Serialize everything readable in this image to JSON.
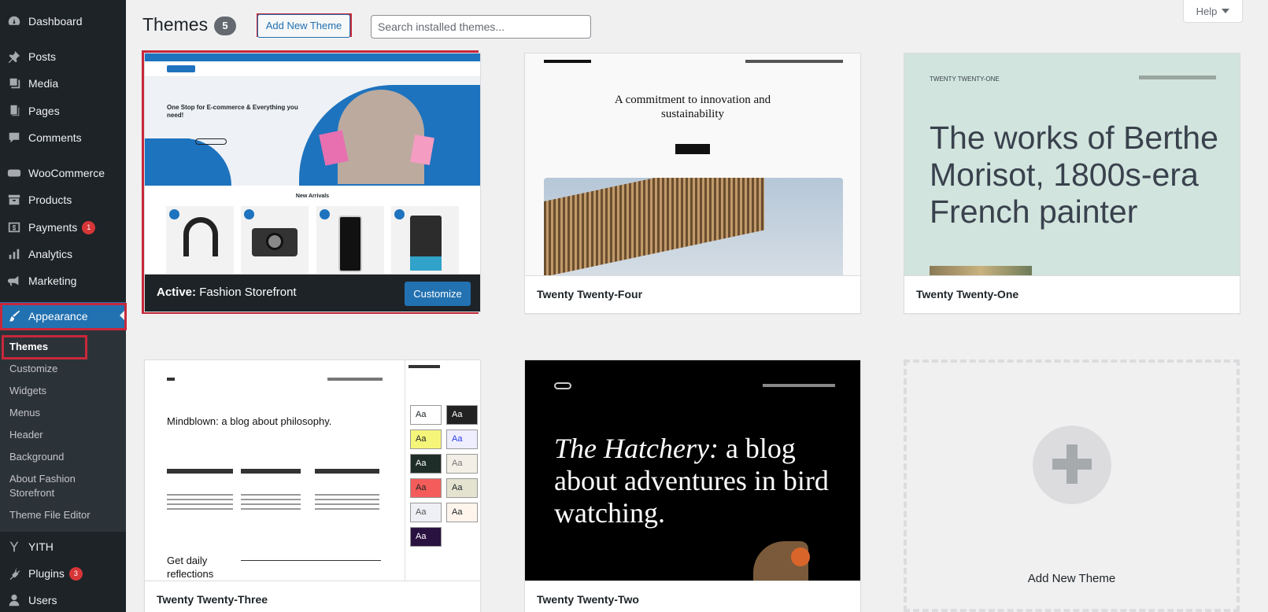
{
  "sidebar": {
    "items": [
      {
        "label": "Dashboard",
        "icon": "dashboard-icon"
      },
      {
        "label": "Posts",
        "icon": "pushpin-icon"
      },
      {
        "label": "Media",
        "icon": "media-icon"
      },
      {
        "label": "Pages",
        "icon": "pages-icon"
      },
      {
        "label": "Comments",
        "icon": "comment-icon"
      },
      {
        "label": "WooCommerce",
        "icon": "woo-icon"
      },
      {
        "label": "Products",
        "icon": "archive-icon"
      },
      {
        "label": "Payments",
        "icon": "payments-icon",
        "badge": "1"
      },
      {
        "label": "Analytics",
        "icon": "chart-bar-icon"
      },
      {
        "label": "Marketing",
        "icon": "megaphone-icon"
      },
      {
        "label": "Appearance",
        "icon": "paintbrush-icon"
      },
      {
        "label": "YITH",
        "icon": "yith-icon"
      },
      {
        "label": "Plugins",
        "icon": "plugin-icon",
        "badge": "3"
      },
      {
        "label": "Users",
        "icon": "users-icon"
      }
    ],
    "submenu": [
      "Themes",
      "Customize",
      "Widgets",
      "Menus",
      "Header",
      "Background",
      "About Fashion Storefront",
      "Theme File Editor"
    ]
  },
  "header": {
    "title": "Themes",
    "count": "5",
    "add_new_label": "Add New Theme",
    "search_placeholder": "Search installed themes...",
    "help_label": "Help"
  },
  "themes": [
    {
      "name": "Fashion Storefront",
      "active_prefix": "Active:",
      "customize_label": "Customize"
    },
    {
      "name": "Twenty Twenty-Four",
      "preview_heading": "A commitment to innovation and sustainability"
    },
    {
      "name": "Twenty Twenty-One",
      "preview_heading": "The works of Berthe Morisot, 1800s-era French painter",
      "preview_site": "TWENTY TWENTY-ONE"
    },
    {
      "name": "Twenty Twenty-Three",
      "preview_heading": "Mindblown: a blog about philosophy.",
      "preview_footer": "Get daily reflections"
    },
    {
      "name": "Twenty Twenty-Two",
      "preview_heading_em": "The Hatchery:",
      "preview_heading_rest": " a blog about adventures in bird watching."
    }
  ],
  "add_card": {
    "label": "Add New Theme"
  },
  "colors": {
    "accent": "#2271b1",
    "highlight": "#c8283b",
    "sidebar": "#1d2327"
  }
}
